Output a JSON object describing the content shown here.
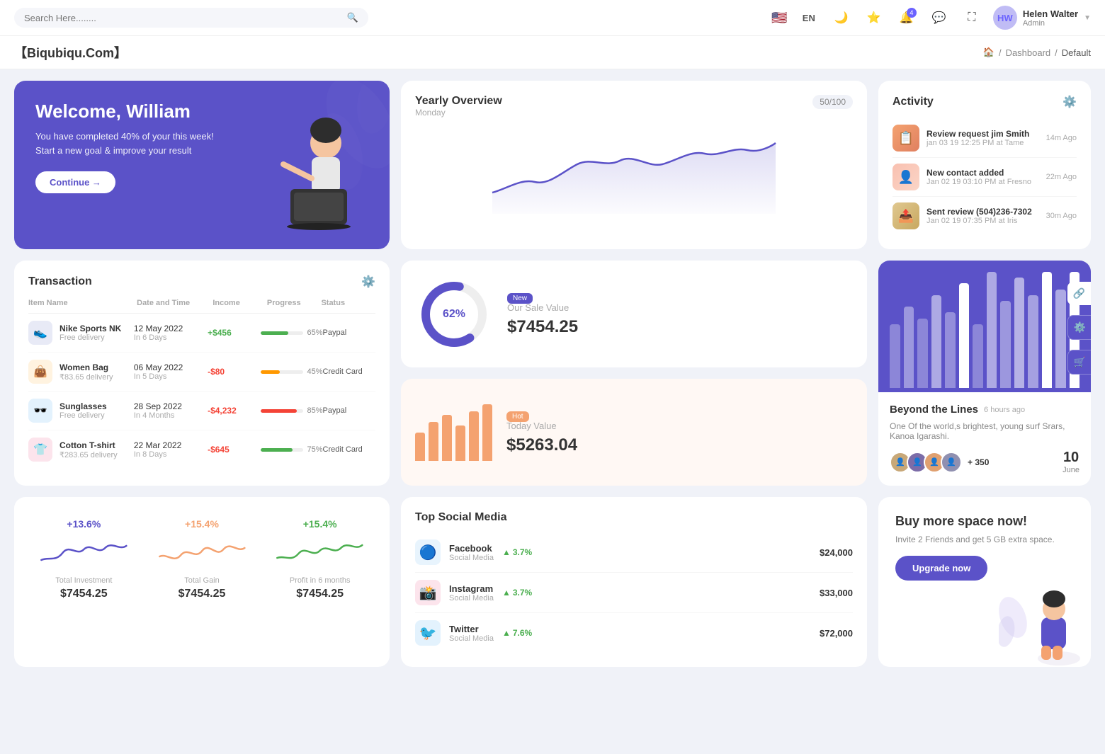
{
  "topnav": {
    "search_placeholder": "Search Here........",
    "lang": "EN",
    "user": {
      "name": "Helen Walter",
      "role": "Admin",
      "initials": "HW"
    },
    "notification_count": "4"
  },
  "breadcrumb": {
    "brand": "【Biqubiqu.Com】",
    "home": "🏠",
    "items": [
      "Dashboard",
      "Default"
    ]
  },
  "welcome": {
    "title": "Welcome, William",
    "subtitle": "You have completed 40% of your this week! Start a new goal & improve your result",
    "button": "Continue →"
  },
  "yearly_overview": {
    "title": "Yearly Overview",
    "subtitle": "Monday",
    "badge": "50/100"
  },
  "activity": {
    "title": "Activity",
    "items": [
      {
        "title": "Review request jim Smith",
        "subtitle": "jan 03 19 12:25 PM at Tame",
        "time": "14m Ago"
      },
      {
        "title": "New contact added",
        "subtitle": "Jan 02 19 03:10 PM at Fresno",
        "time": "22m Ago"
      },
      {
        "title": "Sent review (504)236-7302",
        "subtitle": "Jan 02 19 07:35 PM at Iris",
        "time": "30m Ago"
      }
    ]
  },
  "transaction": {
    "title": "Transaction",
    "headers": [
      "Item Name",
      "Date and Time",
      "Income",
      "Progress",
      "Status"
    ],
    "rows": [
      {
        "icon": "👟",
        "icon_bg": "#e8eaf6",
        "name": "Nike Sports NK",
        "sub": "Free delivery",
        "date": "12 May 2022",
        "date_sub": "In 6 Days",
        "income": "+$456",
        "income_type": "pos",
        "progress": 65,
        "progress_color": "#4caf50",
        "status": "Paypal"
      },
      {
        "icon": "👜",
        "icon_bg": "#fff3e0",
        "name": "Women Bag",
        "sub": "₹83.65 delivery",
        "date": "06 May 2022",
        "date_sub": "In 5 Days",
        "income": "-$80",
        "income_type": "neg",
        "progress": 45,
        "progress_color": "#ff9800",
        "status": "Credit Card"
      },
      {
        "icon": "🕶️",
        "icon_bg": "#e3f2fd",
        "name": "Sunglasses",
        "sub": "Free delivery",
        "date": "28 Sep 2022",
        "date_sub": "In 4 Months",
        "income": "-$4,232",
        "income_type": "neg",
        "progress": 85,
        "progress_color": "#f44336",
        "status": "Paypal"
      },
      {
        "icon": "👕",
        "icon_bg": "#fce4ec",
        "name": "Cotton T-shirt",
        "sub": "₹283.65 delivery",
        "date": "22 Mar 2022",
        "date_sub": "In 8 Days",
        "income": "-$645",
        "income_type": "neg",
        "progress": 75,
        "progress_color": "#4caf50",
        "status": "Credit Card"
      }
    ]
  },
  "sale_value": {
    "badge": "New",
    "donut_pct": "62%",
    "label": "Our Sale Value",
    "value": "$7454.25"
  },
  "today_value": {
    "badge": "Hot",
    "label": "Today Value",
    "value": "$5263.04",
    "bars": [
      40,
      55,
      65,
      50,
      70,
      80
    ]
  },
  "bar_chart": {
    "bars": [
      55,
      80,
      65,
      90,
      70,
      95,
      60,
      100,
      75,
      110,
      85,
      120,
      90,
      130
    ]
  },
  "beyond": {
    "title": "Beyond the Lines",
    "time_ago": "6 hours ago",
    "description": "One Of the world,s brightest, young surf Srars, Kanoa Igarashi.",
    "plus_count": "+ 350",
    "date_num": "10",
    "date_month": "June"
  },
  "stats": [
    {
      "percent": "+13.6%",
      "color": "#5b52c8",
      "label": "Total Investment",
      "value": "$7454.25"
    },
    {
      "percent": "+15.4%",
      "color": "#f4a270",
      "label": "Total Gain",
      "value": "$7454.25"
    },
    {
      "percent": "+15.4%",
      "color": "#4caf50",
      "label": "Profit in 6 months",
      "value": "$7454.25"
    }
  ],
  "social": {
    "title": "Top Social Media",
    "items": [
      {
        "name": "Facebook",
        "sub": "Social Media",
        "icon": "🔵",
        "bg": "#e8f4fd",
        "growth": "3.7%",
        "amount": "$24,000"
      },
      {
        "name": "Instagram",
        "sub": "Social Media",
        "icon": "📸",
        "bg": "#fce4ec",
        "growth": "3.7%",
        "amount": "$33,000"
      },
      {
        "name": "Twitter",
        "sub": "Social Media",
        "icon": "🐦",
        "bg": "#e3f2fd",
        "growth": "7.6%",
        "amount": "$72,000"
      }
    ]
  },
  "upgrade": {
    "title": "Buy more space now!",
    "subtitle": "Invite 2 Friends and get 5 GB extra space.",
    "button": "Upgrade now"
  }
}
